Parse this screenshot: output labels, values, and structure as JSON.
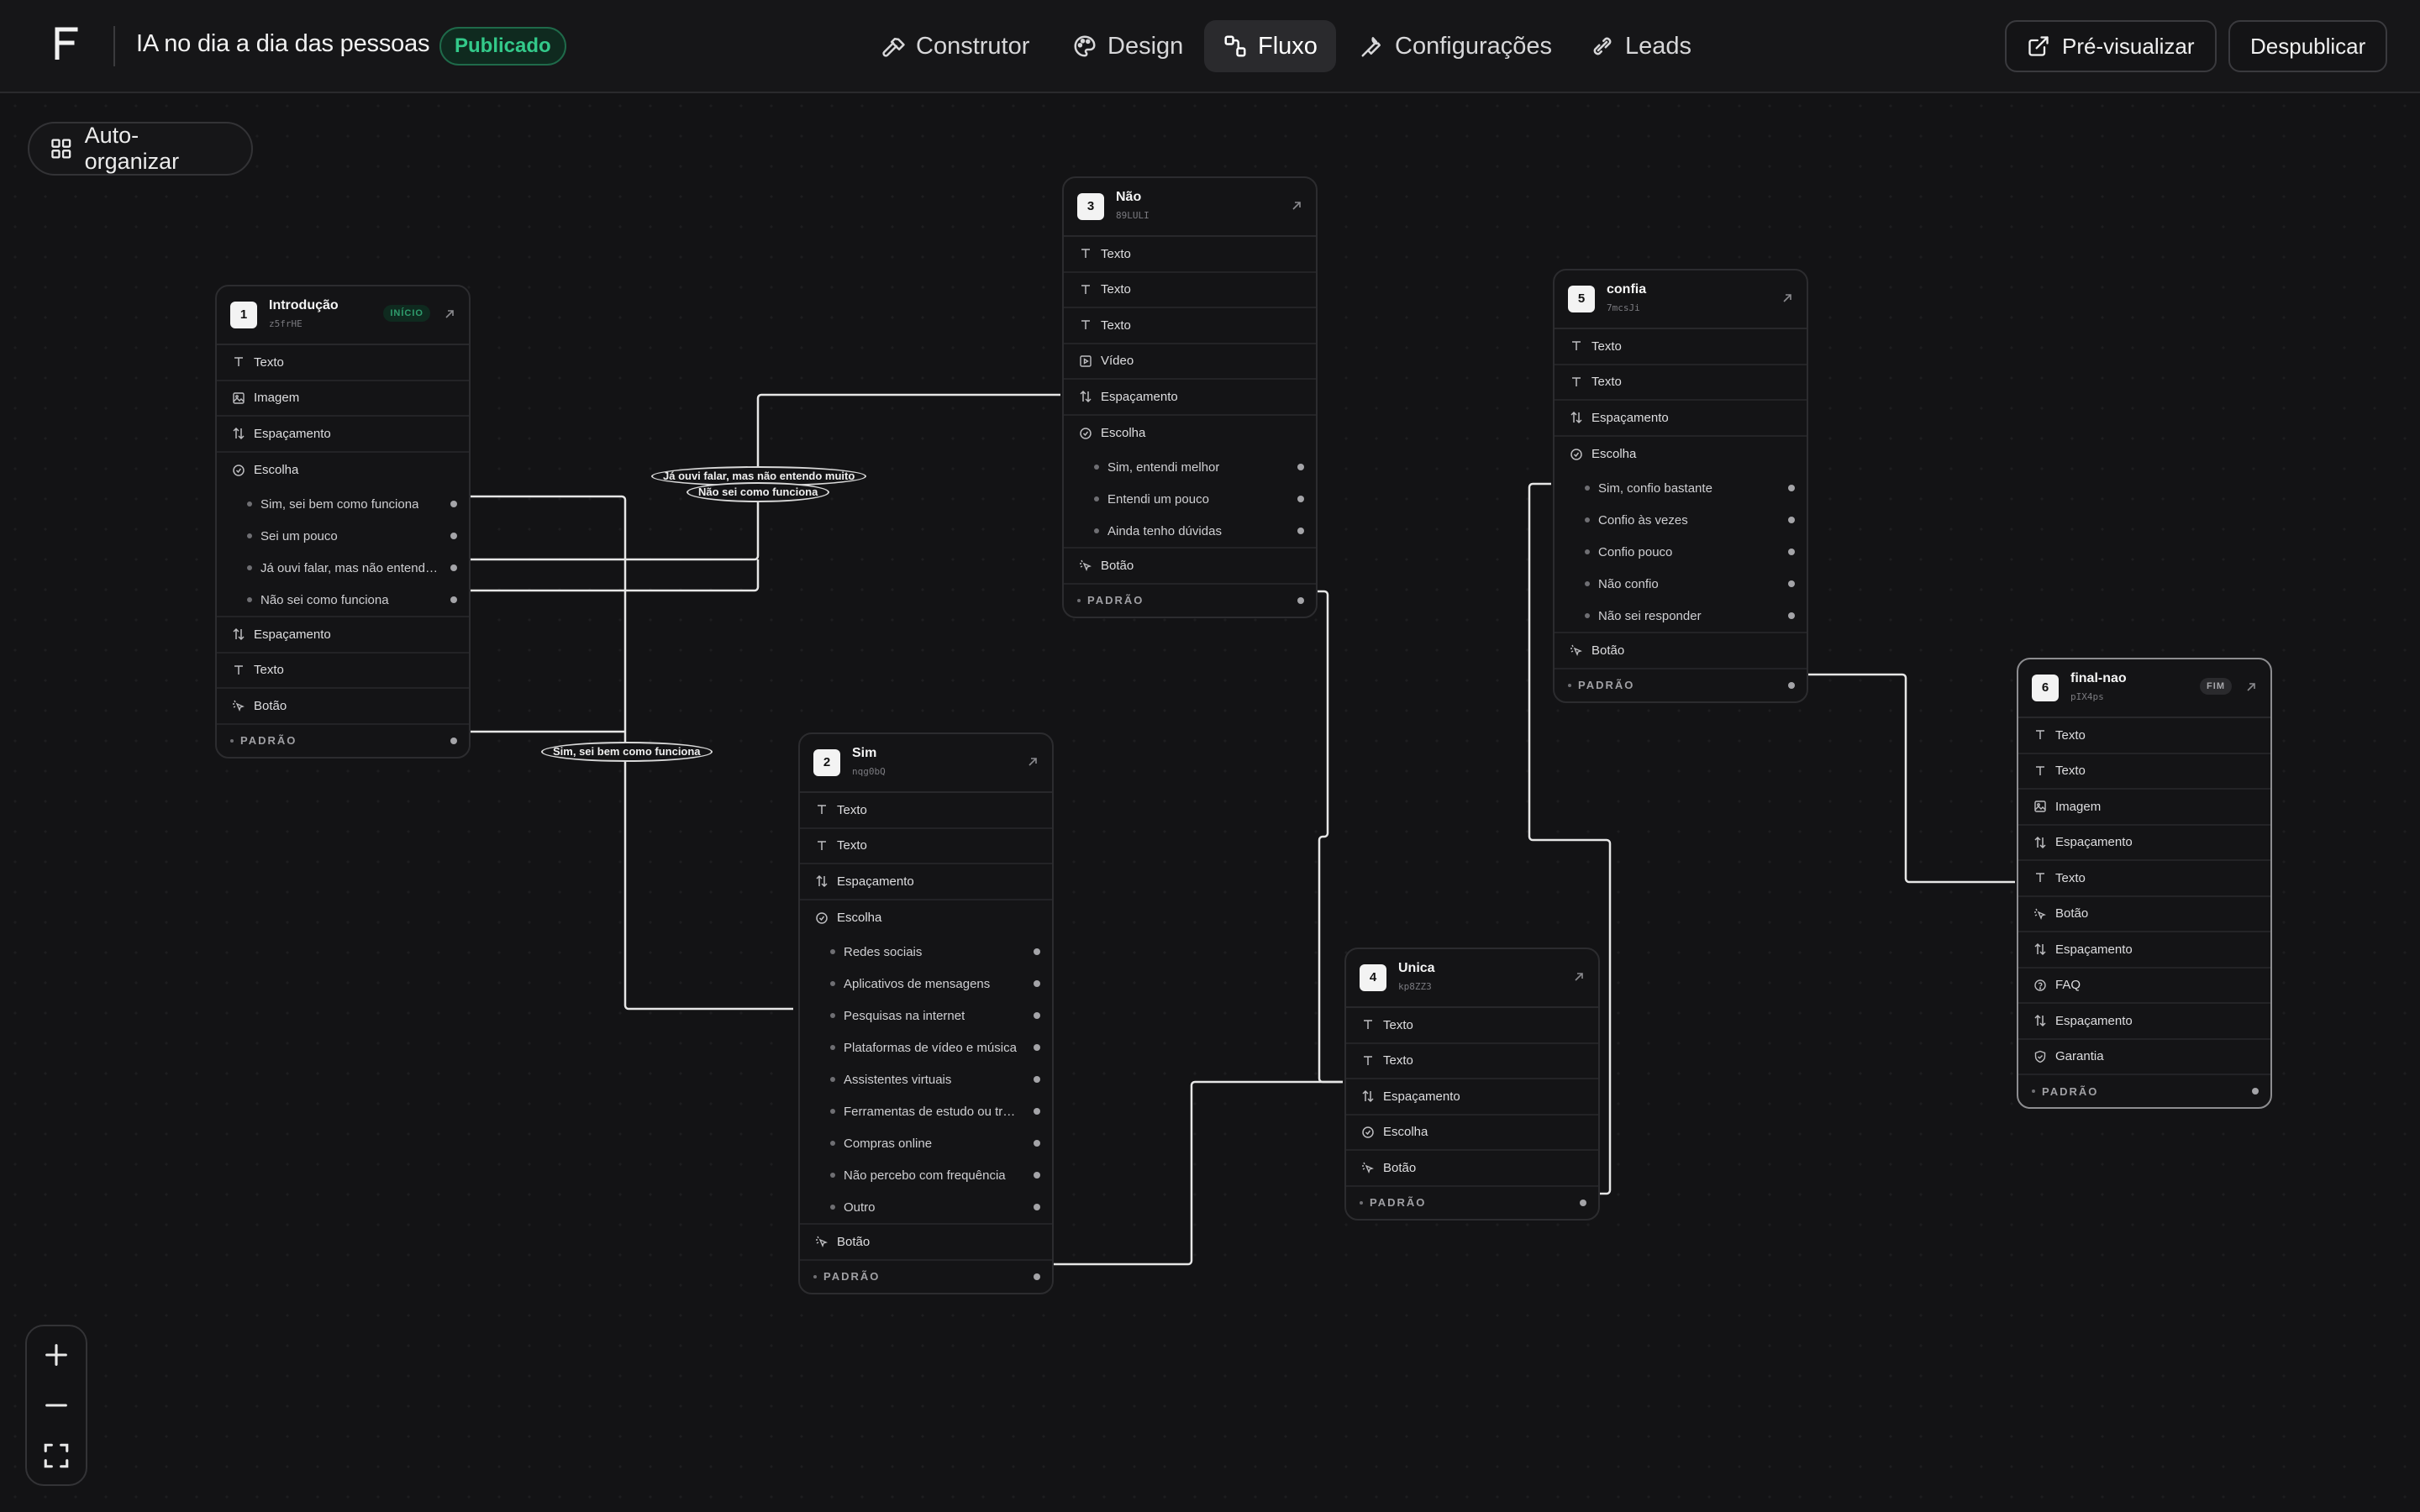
{
  "app": {
    "logo_letter": "F",
    "title": "IA no dia a dia das pessoas",
    "status_badge": "Publicado"
  },
  "nav": {
    "tabs": [
      {
        "label": "Construtor",
        "icon": "hammer-icon"
      },
      {
        "label": "Design",
        "icon": "palette-icon"
      },
      {
        "label": "Fluxo",
        "icon": "flow-icon",
        "active": true
      },
      {
        "label": "Configurações",
        "icon": "wrench-icon"
      },
      {
        "label": "Leads",
        "icon": "leads-icon"
      }
    ],
    "preview_label": "Pré-visualizar",
    "unpublish_label": "Despublicar"
  },
  "canvas": {
    "auto_organize_label": "Auto-organizar",
    "edge_labels": [
      "Já ouvi falar, mas não entendo muito",
      "Não sei como funciona",
      "Sim, sei bem como funciona"
    ]
  },
  "colors": {
    "background": "#131315",
    "published_green": "#33c98a",
    "node_border": "#2c2c2f"
  },
  "nodes": [
    {
      "number": "1",
      "name": "Introdução",
      "id": "z5frHE",
      "tag": "INÍCIO",
      "rows": [
        {
          "type": "Texto",
          "icon": "text-icon"
        },
        {
          "type": "Imagem",
          "icon": "image-icon"
        },
        {
          "type": "Espaçamento",
          "icon": "spacing-icon"
        },
        {
          "type": "Escolha",
          "icon": "choice-icon",
          "options": [
            "Sim, sei bem como funciona",
            "Sei um pouco",
            "Já ouvi falar, mas não entendo muito",
            "Não sei como funciona"
          ]
        },
        {
          "type": "Espaçamento",
          "icon": "spacing-icon"
        },
        {
          "type": "Texto",
          "icon": "text-icon"
        },
        {
          "type": "Botão",
          "icon": "button-icon"
        }
      ],
      "default_label": "PADRÃO"
    },
    {
      "number": "2",
      "name": "Sim",
      "id": "nqg0bQ",
      "tag": "",
      "rows": [
        {
          "type": "Texto",
          "icon": "text-icon"
        },
        {
          "type": "Texto",
          "icon": "text-icon"
        },
        {
          "type": "Espaçamento",
          "icon": "spacing-icon"
        },
        {
          "type": "Escolha",
          "icon": "choice-icon",
          "options": [
            "Redes sociais",
            "Aplicativos de mensagens",
            "Pesquisas na internet",
            "Plataformas de vídeo e música",
            "Assistentes virtuais",
            "Ferramentas de estudo ou trabalho",
            "Compras online",
            "Não percebo com frequência",
            "Outro"
          ]
        },
        {
          "type": "Botão",
          "icon": "button-icon"
        }
      ],
      "default_label": "PADRÃO"
    },
    {
      "number": "3",
      "name": "Não",
      "id": "89LULI",
      "tag": "",
      "rows": [
        {
          "type": "Texto",
          "icon": "text-icon"
        },
        {
          "type": "Texto",
          "icon": "text-icon"
        },
        {
          "type": "Texto",
          "icon": "text-icon"
        },
        {
          "type": "Vídeo",
          "icon": "video-icon"
        },
        {
          "type": "Espaçamento",
          "icon": "spacing-icon"
        },
        {
          "type": "Escolha",
          "icon": "choice-icon",
          "options": [
            "Sim, entendi melhor",
            "Entendi um pouco",
            "Ainda tenho dúvidas"
          ]
        },
        {
          "type": "Botão",
          "icon": "button-icon"
        }
      ],
      "default_label": "PADRÃO"
    },
    {
      "number": "4",
      "name": "Unica",
      "id": "kp8ZZ3",
      "tag": "",
      "rows": [
        {
          "type": "Texto",
          "icon": "text-icon"
        },
        {
          "type": "Texto",
          "icon": "text-icon"
        },
        {
          "type": "Espaçamento",
          "icon": "spacing-icon"
        },
        {
          "type": "Escolha",
          "icon": "choice-icon"
        },
        {
          "type": "Botão",
          "icon": "button-icon"
        }
      ],
      "default_label": "PADRÃO"
    },
    {
      "number": "5",
      "name": "confia",
      "id": "7mcsJi",
      "tag": "",
      "rows": [
        {
          "type": "Texto",
          "icon": "text-icon"
        },
        {
          "type": "Texto",
          "icon": "text-icon"
        },
        {
          "type": "Espaçamento",
          "icon": "spacing-icon"
        },
        {
          "type": "Escolha",
          "icon": "choice-icon",
          "options": [
            "Sim, confio bastante",
            "Confio às vezes",
            "Confio pouco",
            "Não confio",
            "Não sei responder"
          ]
        },
        {
          "type": "Botão",
          "icon": "button-icon"
        }
      ],
      "default_label": "PADRÃO"
    },
    {
      "number": "6",
      "name": "final-nao",
      "id": "pIX4ps",
      "tag": "FIM",
      "rows": [
        {
          "type": "Texto",
          "icon": "text-icon"
        },
        {
          "type": "Texto",
          "icon": "text-icon"
        },
        {
          "type": "Imagem",
          "icon": "image-icon"
        },
        {
          "type": "Espaçamento",
          "icon": "spacing-icon"
        },
        {
          "type": "Texto",
          "icon": "text-icon"
        },
        {
          "type": "Botão",
          "icon": "button-icon"
        },
        {
          "type": "Espaçamento",
          "icon": "spacing-icon"
        },
        {
          "type": "FAQ",
          "icon": "faq-icon"
        },
        {
          "type": "Espaçamento",
          "icon": "spacing-icon"
        },
        {
          "type": "Garantia",
          "icon": "shield-icon"
        }
      ],
      "default_label": "PADRÃO"
    }
  ]
}
